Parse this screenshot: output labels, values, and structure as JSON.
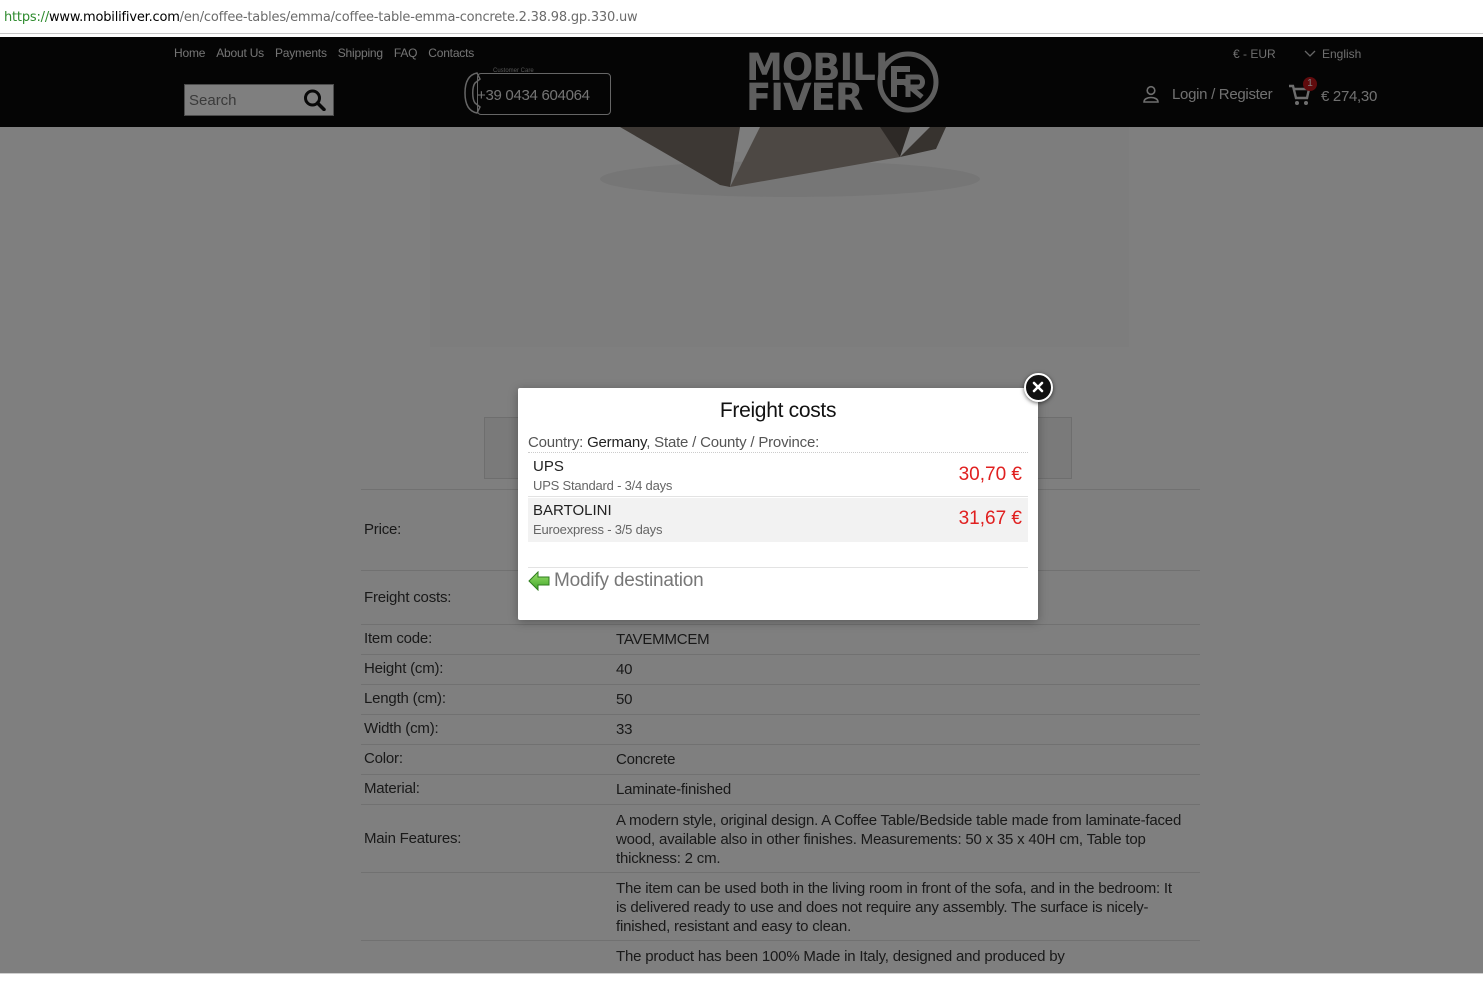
{
  "browser": {
    "url_scheme": "https://",
    "url_host": "www.mobilifiver.com",
    "url_path": "/en/coffee-tables/emma/coffee-table-emma-concrete.2.38.98.gp.330.uw"
  },
  "header": {
    "nav": [
      "Home",
      "About Us",
      "Payments",
      "Shipping",
      "FAQ",
      "Contacts"
    ],
    "search_placeholder": "Search",
    "customer_care_label": "Customer Care",
    "phone": "+39 0434 604064",
    "logo_line1": "MOBILI",
    "logo_line2": "FIVER",
    "currency": "€ - EUR",
    "language": "English",
    "login": "Login / Register",
    "cart_count": "1",
    "cart_total": "€ 274,30"
  },
  "specs": [
    {
      "label": "Price:",
      "value": ""
    },
    {
      "label": "Freight costs:",
      "value": ""
    },
    {
      "label": "Item code:",
      "value": "TAVEMMCEM"
    },
    {
      "label": "Height (cm):",
      "value": "40"
    },
    {
      "label": "Length (cm):",
      "value": "50"
    },
    {
      "label": "Width (cm):",
      "value": "33"
    },
    {
      "label": "Color:",
      "value": "Concrete"
    },
    {
      "label": "Material:",
      "value": "Laminate-finished"
    },
    {
      "label": "Main Features:",
      "value": "A modern style, original design. A Coffee Table/Bedside table made from laminate-faced wood, available also in other finishes. Measurements: 50 x 35 x 40H cm, Table top thickness: 2 cm."
    },
    {
      "label": "",
      "value": "The item can be used both in the living room in front of the sofa, and in the bedroom: It is delivered ready to use and does not require any assembly. The surface is nicely-finished, resistant and easy to clean."
    },
    {
      "label": "",
      "value": "The product has been 100% Made in Italy, designed and produced by"
    }
  ],
  "modal": {
    "title": "Freight costs",
    "country_label": "Country:",
    "country": "Germany",
    "state_label": "State / County / Province:",
    "carriers": [
      {
        "name": "UPS",
        "service": "UPS Standard - 3/4 days",
        "price": "30,70 €"
      },
      {
        "name": "BARTOLINI",
        "service": "Euroexpress - 3/5 days",
        "price": "31,67 €"
      }
    ],
    "modify_label": "Modify destination",
    "price_color": "#e02020"
  }
}
